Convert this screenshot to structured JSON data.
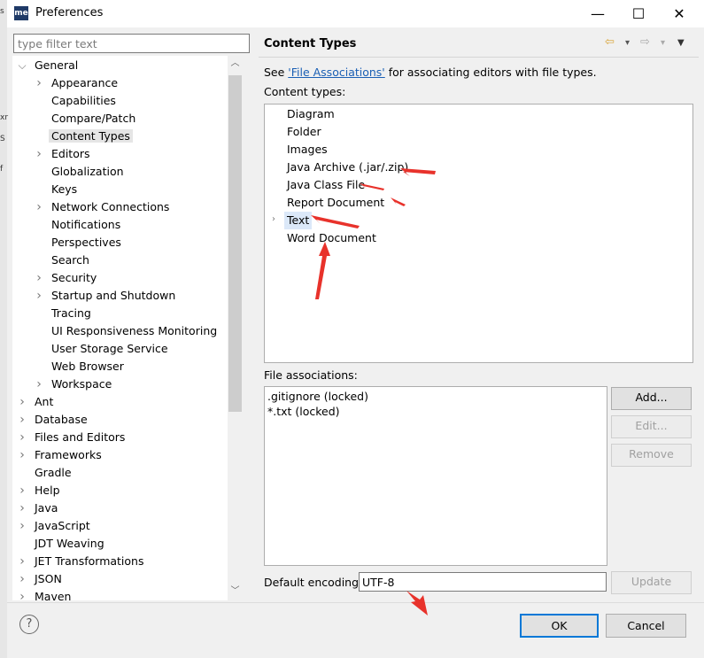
{
  "window": {
    "app_icon": "me",
    "title": "Preferences",
    "minimize": "—",
    "maximize": "☐",
    "close": "✕"
  },
  "left_edge": [
    "s",
    "xr",
    "S",
    "f"
  ],
  "filter": {
    "placeholder": "type filter text",
    "value": ""
  },
  "tree": [
    {
      "label": "General",
      "level": 0,
      "twisty": "open"
    },
    {
      "label": "Appearance",
      "level": 1,
      "twisty": "closed"
    },
    {
      "label": "Capabilities",
      "level": 1,
      "twisty": ""
    },
    {
      "label": "Compare/Patch",
      "level": 1,
      "twisty": ""
    },
    {
      "label": "Content Types",
      "level": 1,
      "twisty": "",
      "selected": true
    },
    {
      "label": "Editors",
      "level": 1,
      "twisty": "closed"
    },
    {
      "label": "Globalization",
      "level": 1,
      "twisty": ""
    },
    {
      "label": "Keys",
      "level": 1,
      "twisty": ""
    },
    {
      "label": "Network Connections",
      "level": 1,
      "twisty": "closed"
    },
    {
      "label": "Notifications",
      "level": 1,
      "twisty": ""
    },
    {
      "label": "Perspectives",
      "level": 1,
      "twisty": ""
    },
    {
      "label": "Search",
      "level": 1,
      "twisty": ""
    },
    {
      "label": "Security",
      "level": 1,
      "twisty": "closed"
    },
    {
      "label": "Startup and Shutdown",
      "level": 1,
      "twisty": "closed"
    },
    {
      "label": "Tracing",
      "level": 1,
      "twisty": ""
    },
    {
      "label": "UI Responsiveness Monitoring",
      "level": 1,
      "twisty": ""
    },
    {
      "label": "User Storage Service",
      "level": 1,
      "twisty": ""
    },
    {
      "label": "Web Browser",
      "level": 1,
      "twisty": ""
    },
    {
      "label": "Workspace",
      "level": 1,
      "twisty": "closed"
    },
    {
      "label": "Ant",
      "level": 0,
      "twisty": "closed"
    },
    {
      "label": "Database",
      "level": 0,
      "twisty": "closed"
    },
    {
      "label": "Files and Editors",
      "level": 0,
      "twisty": "closed"
    },
    {
      "label": "Frameworks",
      "level": 0,
      "twisty": "closed"
    },
    {
      "label": "Gradle",
      "level": 0,
      "twisty": ""
    },
    {
      "label": "Help",
      "level": 0,
      "twisty": "closed"
    },
    {
      "label": "Java",
      "level": 0,
      "twisty": "closed"
    },
    {
      "label": "JavaScript",
      "level": 0,
      "twisty": "closed"
    },
    {
      "label": "JDT Weaving",
      "level": 0,
      "twisty": ""
    },
    {
      "label": "JET Transformations",
      "level": 0,
      "twisty": "closed"
    },
    {
      "label": "JSON",
      "level": 0,
      "twisty": "closed"
    },
    {
      "label": "Maven",
      "level": 0,
      "twisty": "closed"
    }
  ],
  "scrollbar": {
    "up": "︿",
    "down": "﹀"
  },
  "page": {
    "title": "Content Types",
    "nav": {
      "back": "⇦",
      "back_menu": "▾",
      "forward": "⇨",
      "forward_menu": "▾",
      "view_menu": "▼"
    },
    "see_prefix": "See ",
    "see_link": "'File Associations'",
    "see_suffix": " for associating editors with file types.",
    "content_types_label": "Content types:",
    "content_types": [
      {
        "label": "Diagram"
      },
      {
        "label": "Folder"
      },
      {
        "label": "Images"
      },
      {
        "label": "Java Archive (.jar/.zip)"
      },
      {
        "label": "Java Class File"
      },
      {
        "label": "Report Document"
      },
      {
        "label": "Text",
        "selected": true,
        "twisty": "closed"
      },
      {
        "label": "Word Document"
      }
    ],
    "content_type_twisty": "›",
    "file_assoc_label": "File associations:",
    "file_associations": [
      ".gitignore (locked)",
      "*.txt (locked)"
    ],
    "buttons": {
      "add": "Add...",
      "edit": "Edit...",
      "remove": "Remove",
      "update": "Update"
    },
    "encoding_label": "Default encoding:",
    "encoding_value": "UTF-8"
  },
  "footer": {
    "help": "?",
    "ok": "OK",
    "cancel": "Cancel"
  },
  "colors": {
    "annotation_arrow": "#e8322b",
    "selection": "#dbe8f8",
    "link": "#1a5fb4"
  }
}
